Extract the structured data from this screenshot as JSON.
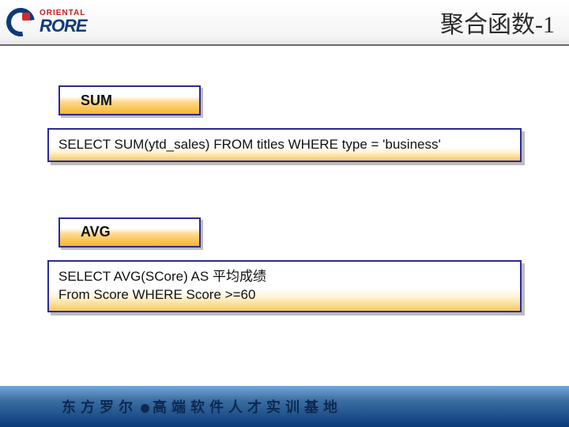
{
  "logo": {
    "top_text": "ORIENTAL",
    "main_text": "RORE"
  },
  "title": "聚合函数-1",
  "sections": [
    {
      "label": "SUM",
      "code": "SELECT SUM(ytd_sales) FROM titles WHERE type = 'business'"
    },
    {
      "label": "AVG",
      "code": "SELECT AVG(SCore) AS 平均成绩\nFrom Score WHERE Score >=60"
    }
  ],
  "footer": {
    "left": "东方罗尔",
    "right": "高端软件人才实训基地"
  }
}
